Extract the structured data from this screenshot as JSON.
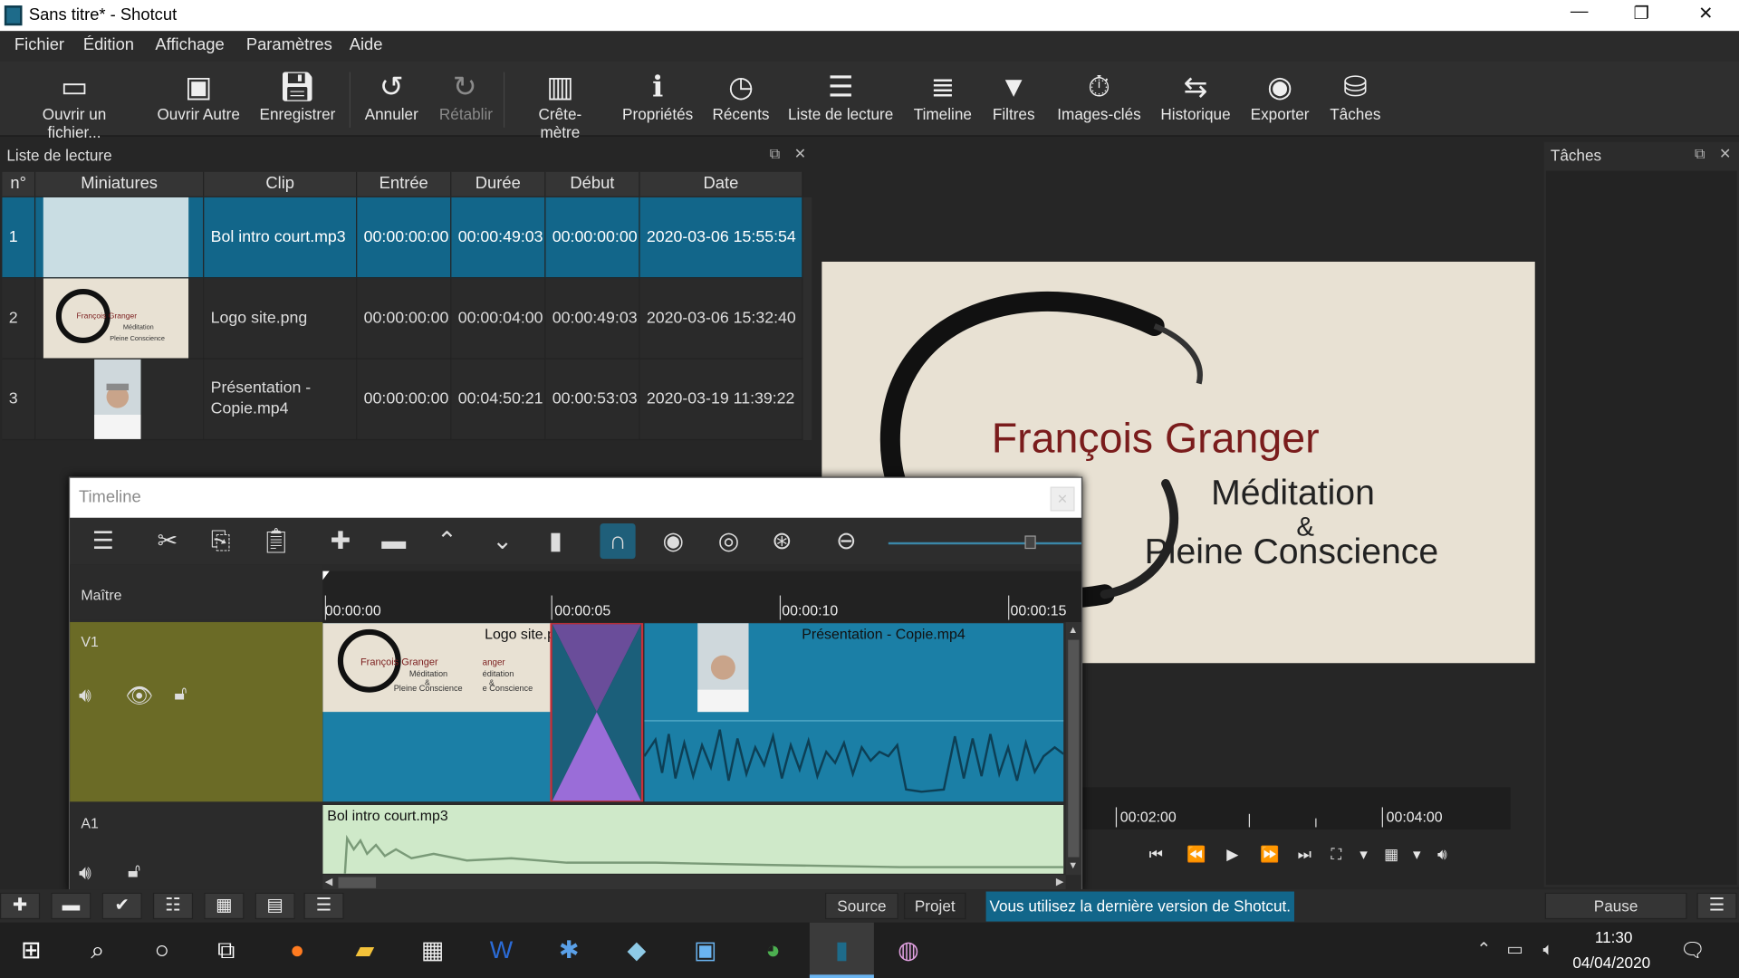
{
  "window": {
    "title": "Sans titre* - Shotcut",
    "minimize": "—",
    "maximize": "❐",
    "close": "✕"
  },
  "menu": [
    "Fichier",
    "Édition",
    "Affichage",
    "Paramètres",
    "Aide"
  ],
  "toolbar": {
    "open_file": "Ouvrir un fichier...",
    "open_other": "Ouvrir Autre",
    "save": "Enregistrer",
    "undo": "Annuler",
    "redo": "Rétablir",
    "peak_meter": "Crête-mètre",
    "properties": "Propriétés",
    "recent": "Récents",
    "playlist": "Liste de lecture",
    "timeline": "Timeline",
    "filters": "Filtres",
    "keyframes": "Images-clés",
    "history": "Historique",
    "export": "Exporter",
    "jobs": "Tâches"
  },
  "playlist": {
    "title": "Liste de lecture",
    "columns": [
      "n°",
      "Miniatures",
      "Clip",
      "Entrée",
      "Durée",
      "Début",
      "Date"
    ],
    "rows": [
      {
        "n": "1",
        "clip": "Bol intro court.mp3",
        "in": "00:00:00:00",
        "duration": "00:00:49:03",
        "start": "00:00:00:00",
        "date": "2020-03-06 15:55:54"
      },
      {
        "n": "2",
        "clip": "Logo site.png",
        "in": "00:00:00:00",
        "duration": "00:00:04:00",
        "start": "00:00:49:03",
        "date": "2020-03-06 15:32:40"
      },
      {
        "n": "3",
        "clip": "Présentation - Copie.mp4",
        "in": "00:00:00:00",
        "duration": "00:04:50:21",
        "start": "00:00:53:03",
        "date": "2020-03-19 11:39:22"
      }
    ]
  },
  "preview": {
    "name": "François Granger",
    "line1": "Méditation",
    "amp": "&",
    "line2": "Pleine Conscience"
  },
  "tasks_panel": {
    "title": "Tâches",
    "pause": "Pause"
  },
  "timeline": {
    "title": "Timeline",
    "tracks": {
      "master": "Maître",
      "v1": "V1",
      "a1": "A1"
    },
    "ruler": [
      "00:00:00",
      "00:00:05",
      "00:00:10",
      "00:00:15"
    ],
    "clips": {
      "logo": "Logo site.p",
      "presentation": "Présentation - Copie.mp4",
      "audio": "Bol intro court.mp3"
    },
    "thumb_logo": {
      "name": "François Granger",
      "l1": "Méditation",
      "amp": "&",
      "l2": "Pleine Conscience"
    },
    "thumb_logo_cut": {
      "name": "anger",
      "l1": "éditation",
      "amp": "&",
      "l2": "e Conscience"
    },
    "zoom_level": 0.75
  },
  "player": {
    "timecode_a": "00:02:00",
    "timecode_b": "00:04:00"
  },
  "bottom": {
    "source_tab": "Source",
    "project_tab": "Projet",
    "status": "Vous utilisez la dernière version de Shotcut."
  },
  "taskbar": {
    "time": "11:30",
    "date": "04/04/2020"
  },
  "colors": {
    "selection": "#12668a",
    "video_track": "#6b6b26",
    "clip_blue": "#1b7fa6",
    "transition": "#8a5fc6",
    "audio_clip": "#cfe9c9"
  }
}
